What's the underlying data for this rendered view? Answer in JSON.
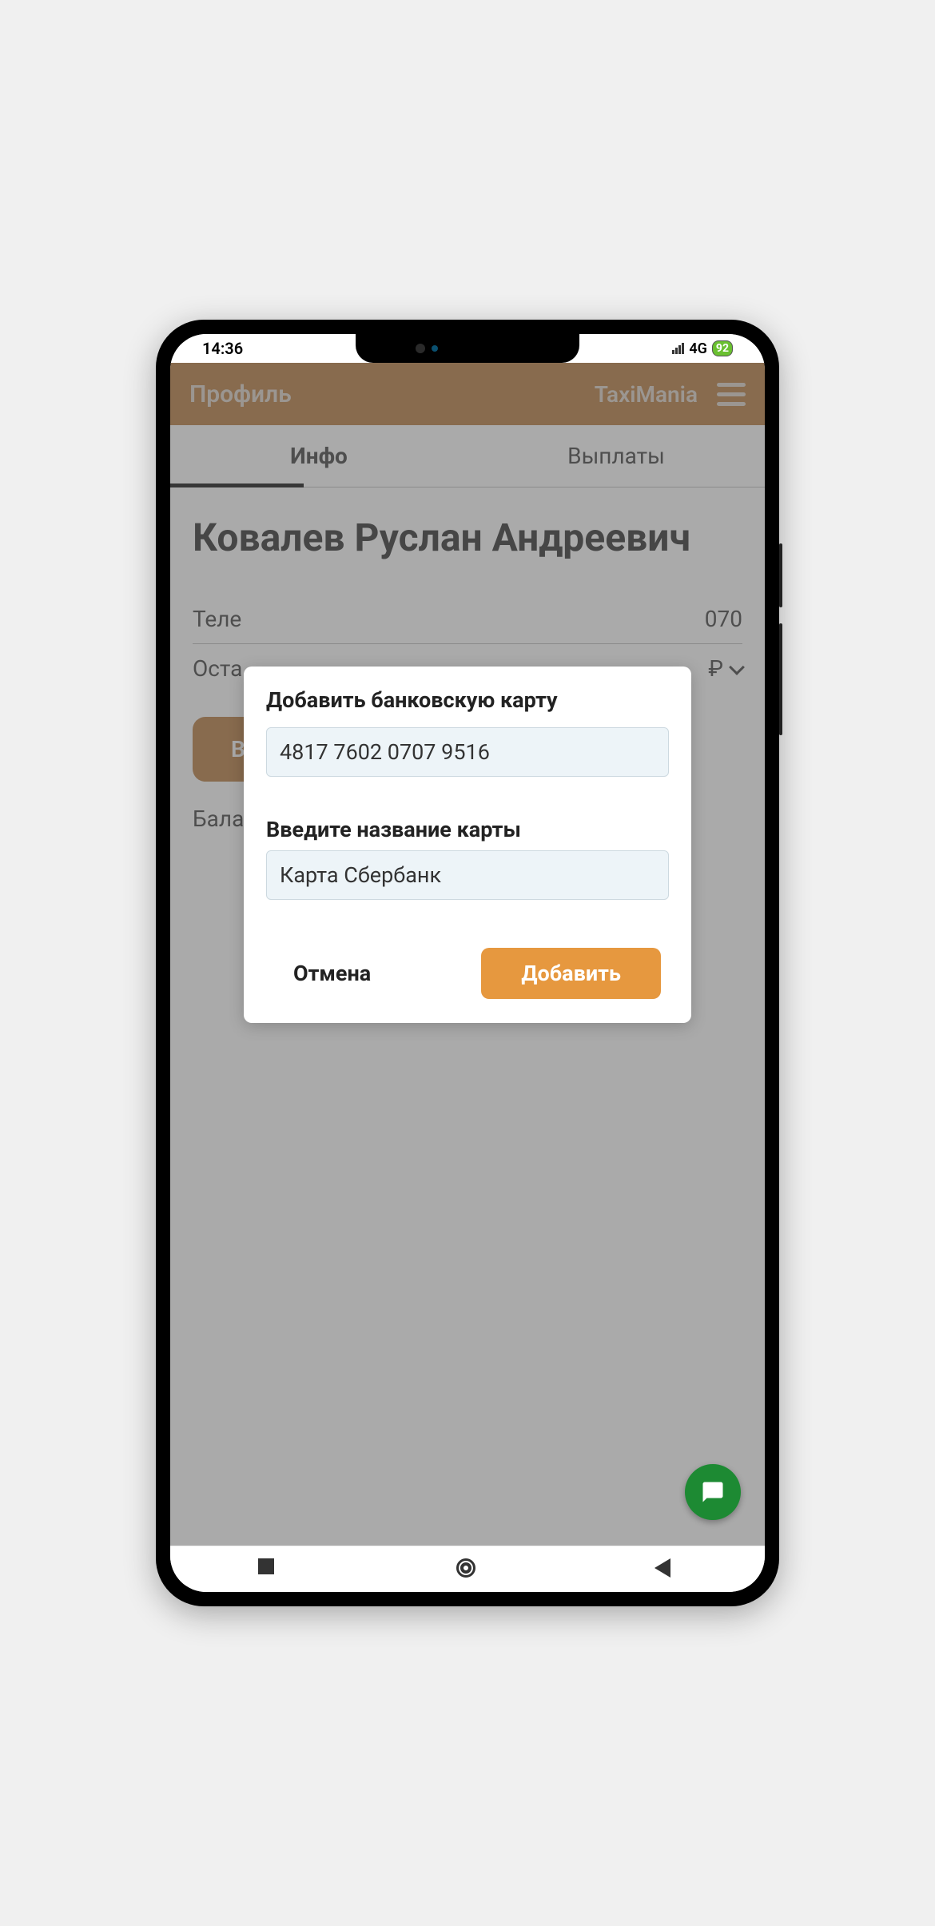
{
  "status": {
    "time": "14:36",
    "network": "4G",
    "battery": "92"
  },
  "header": {
    "title": "Профиль",
    "app_name": "TaxiMania"
  },
  "tabs": {
    "info": "Инфо",
    "payouts": "Выплаты"
  },
  "profile": {
    "full_name": "Ковалев Руслан Андреевич",
    "phone_label": "Теле",
    "phone_suffix": "070",
    "balance_row_label": "Оста",
    "balance_button_prefix": "В",
    "balance_label": "Бала"
  },
  "dialog": {
    "title": "Добавить банковскую карту",
    "card_number": "4817 7602 0707 9516",
    "name_label": "Введите название карты",
    "card_name": "Карта Сбербанк",
    "cancel": "Отмена",
    "add": "Добавить"
  }
}
